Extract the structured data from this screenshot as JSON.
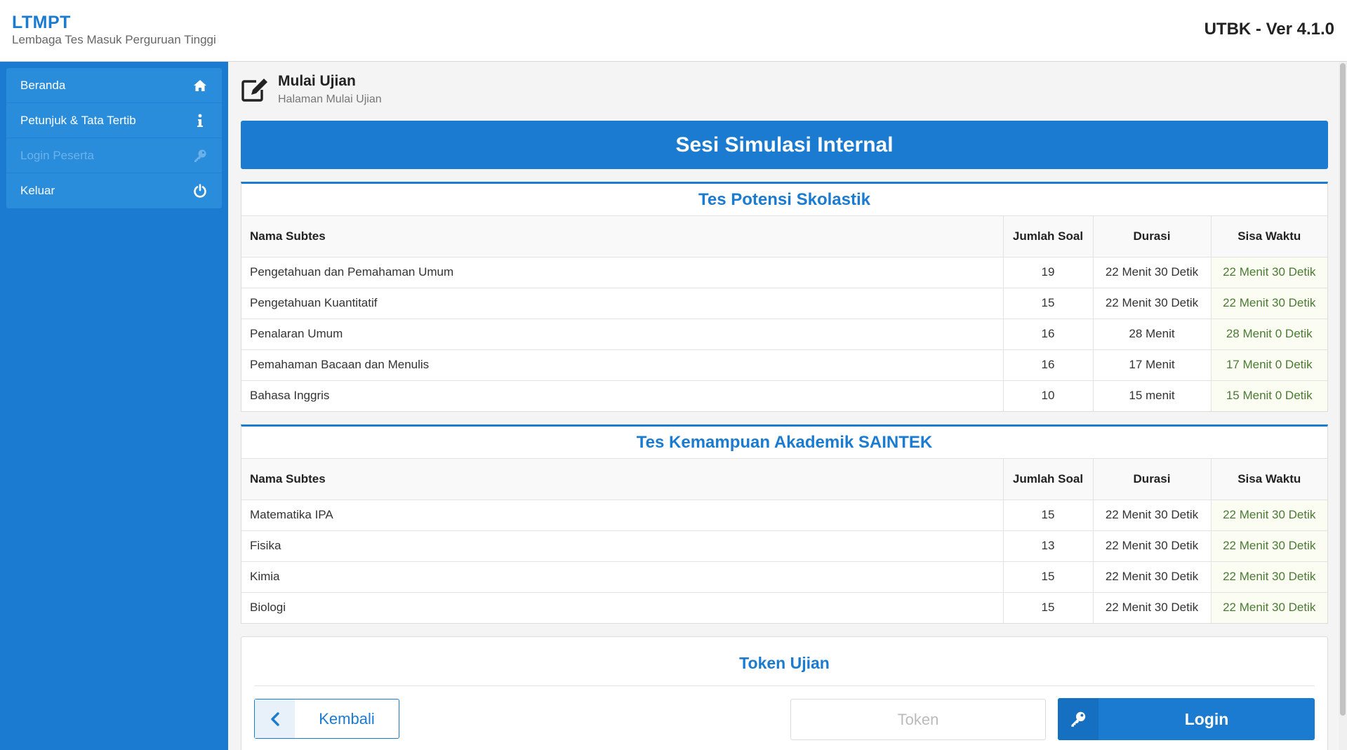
{
  "header": {
    "brand": "LTMPT",
    "brand_subtitle": "Lembaga Tes Masuk Perguruan Tinggi",
    "version": "UTBK - Ver 4.1.0"
  },
  "sidebar": {
    "items": [
      {
        "label": "Beranda",
        "icon": "home-icon",
        "disabled": false
      },
      {
        "label": "Petunjuk & Tata Tertib",
        "icon": "info-icon",
        "disabled": false
      },
      {
        "label": "Login Peserta",
        "icon": "key-icon",
        "disabled": true
      },
      {
        "label": "Keluar",
        "icon": "power-icon",
        "disabled": false
      }
    ]
  },
  "page": {
    "title": "Mulai Ujian",
    "subtitle": "Halaman Mulai Ujian",
    "session": "Sesi Simulasi Internal"
  },
  "columns": {
    "name": "Nama Subtes",
    "count": "Jumlah Soal",
    "duration": "Durasi",
    "remaining": "Sisa Waktu"
  },
  "tps": {
    "title": "Tes Potensi Skolastik",
    "rows": [
      {
        "name": "Pengetahuan dan Pemahaman Umum",
        "count": "19",
        "duration": "22 Menit 30 Detik",
        "remaining": "22 Menit 30 Detik"
      },
      {
        "name": "Pengetahuan Kuantitatif",
        "count": "15",
        "duration": "22 Menit 30 Detik",
        "remaining": "22 Menit 30 Detik"
      },
      {
        "name": "Penalaran Umum",
        "count": "16",
        "duration": "28 Menit",
        "remaining": "28 Menit 0 Detik"
      },
      {
        "name": "Pemahaman Bacaan dan Menulis",
        "count": "16",
        "duration": "17 Menit",
        "remaining": "17 Menit 0 Detik"
      },
      {
        "name": "Bahasa Inggris",
        "count": "10",
        "duration": "15 menit",
        "remaining": "15 Menit 0 Detik"
      }
    ]
  },
  "tka": {
    "title": "Tes Kemampuan Akademik SAINTEK",
    "rows": [
      {
        "name": "Matematika IPA",
        "count": "15",
        "duration": "22 Menit 30 Detik",
        "remaining": "22 Menit 30 Detik"
      },
      {
        "name": "Fisika",
        "count": "13",
        "duration": "22 Menit 30 Detik",
        "remaining": "22 Menit 30 Detik"
      },
      {
        "name": "Kimia",
        "count": "15",
        "duration": "22 Menit 30 Detik",
        "remaining": "22 Menit 30 Detik"
      },
      {
        "name": "Biologi",
        "count": "15",
        "duration": "22 Menit 30 Detik",
        "remaining": "22 Menit 30 Detik"
      }
    ]
  },
  "token": {
    "title": "Token Ujian",
    "back_label": "Kembali",
    "placeholder": "Token",
    "value": "",
    "login_label": "Login"
  },
  "colors": {
    "primary": "#1a7bd0",
    "remaining_text": "#4a7a33"
  }
}
